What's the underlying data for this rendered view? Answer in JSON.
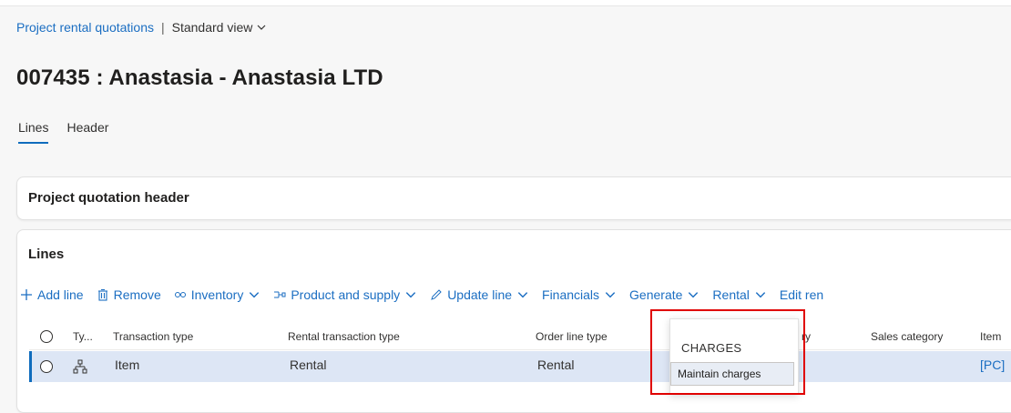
{
  "breadcrumb": {
    "link": "Project rental quotations",
    "separator": "|",
    "view": "Standard view"
  },
  "page": {
    "title": "007435 : Anastasia - Anastasia LTD"
  },
  "tabs": [
    {
      "label": "Lines",
      "active": true
    },
    {
      "label": "Header",
      "active": false
    }
  ],
  "header_card": {
    "title": "Project quotation header"
  },
  "lines_card": {
    "title": "Lines",
    "toolbar": {
      "add_line": "Add line",
      "remove": "Remove",
      "inventory": "Inventory",
      "product_supply": "Product and supply",
      "update_line": "Update line",
      "financials": "Financials",
      "generate": "Generate",
      "rental": "Rental",
      "edit_rental": "Edit ren"
    },
    "columns": {
      "type": "Ty...",
      "transaction_type": "Transaction type",
      "rental_transaction_type": "Rental transaction type",
      "order_line_type": "Order line type",
      "category_partial": "ry",
      "sales_category": "Sales category",
      "item": "Item"
    },
    "row": {
      "transaction_type": "Item",
      "rental_transaction_type": "Rental",
      "order_line_type": "Rental",
      "item": "[PC]"
    }
  },
  "financials_menu": {
    "section": "CHARGES",
    "item": "Maintain charges"
  },
  "colors": {
    "accent": "#0f6cbd",
    "link": "#1b6ec2",
    "highlight": "#e00000",
    "selected_row": "#dde6f5"
  }
}
